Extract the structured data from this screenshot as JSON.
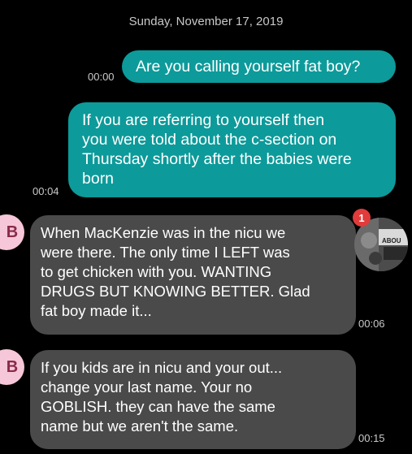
{
  "date_header": "Sunday, November 17, 2019",
  "messages": [
    {
      "time": "00:00",
      "text": "Are you calling yourself fat boy?"
    },
    {
      "time": "00:04",
      "text": "If you are referring to yourself then\nyou were told about the c-section on\nThursday shortly after the babies were\nborn"
    },
    {
      "time": "00:06",
      "text": "When MacKenzie was in the nicu we\nwere there. The only time I LEFT was\nto get chicken with you. WANTING\nDRUGS BUT KNOWING BETTER. Glad\nfat boy made it...",
      "avatar_letter": "B"
    },
    {
      "time": "00:15",
      "text": "If you kids are in nicu and your out...\nchange your last name. Your no\nGOBLISH. they can have the same\nname but we aren't the same.",
      "avatar_letter": "B"
    }
  ],
  "contact_avatar": {
    "badge_count": "1",
    "photo_text": "ABOU"
  },
  "colors": {
    "outgoing": "#0d9a9a",
    "incoming": "#4a4a4a",
    "avatar": "#f6c7d8",
    "badge": "#e23b3b"
  }
}
